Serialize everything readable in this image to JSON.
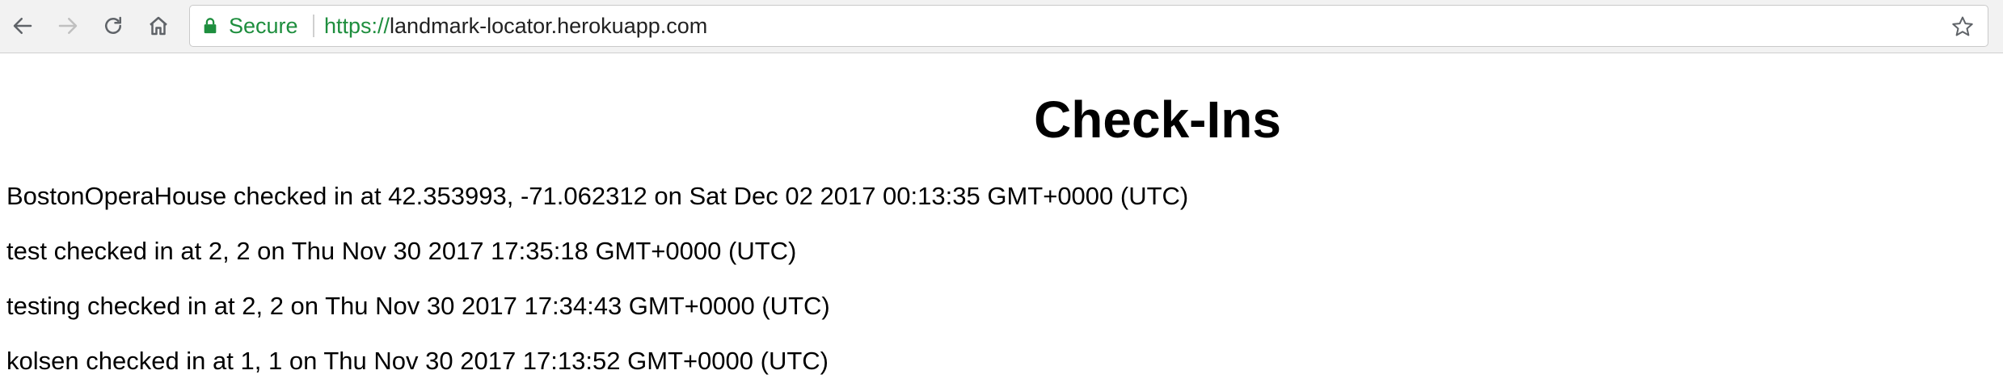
{
  "browser": {
    "secure_label": "Secure",
    "url_scheme": "https://",
    "url_rest": "landmark-locator.herokuapp.com",
    "icons": [
      "back-arrow-icon",
      "forward-arrow-icon",
      "reload-icon",
      "home-icon",
      "lock-icon",
      "star-icon"
    ],
    "secure_color": "#1e8e3e"
  },
  "page": {
    "title": "Check-Ins",
    "checkins": [
      "BostonOperaHouse checked in at 42.353993, -71.062312 on Sat Dec 02 2017 00:13:35 GMT+0000 (UTC)",
      "test checked in at 2, 2 on Thu Nov 30 2017 17:35:18 GMT+0000 (UTC)",
      "testing checked in at 2, 2 on Thu Nov 30 2017 17:34:43 GMT+0000 (UTC)",
      "kolsen checked in at 1, 1 on Thu Nov 30 2017 17:13:52 GMT+0000 (UTC)"
    ]
  }
}
